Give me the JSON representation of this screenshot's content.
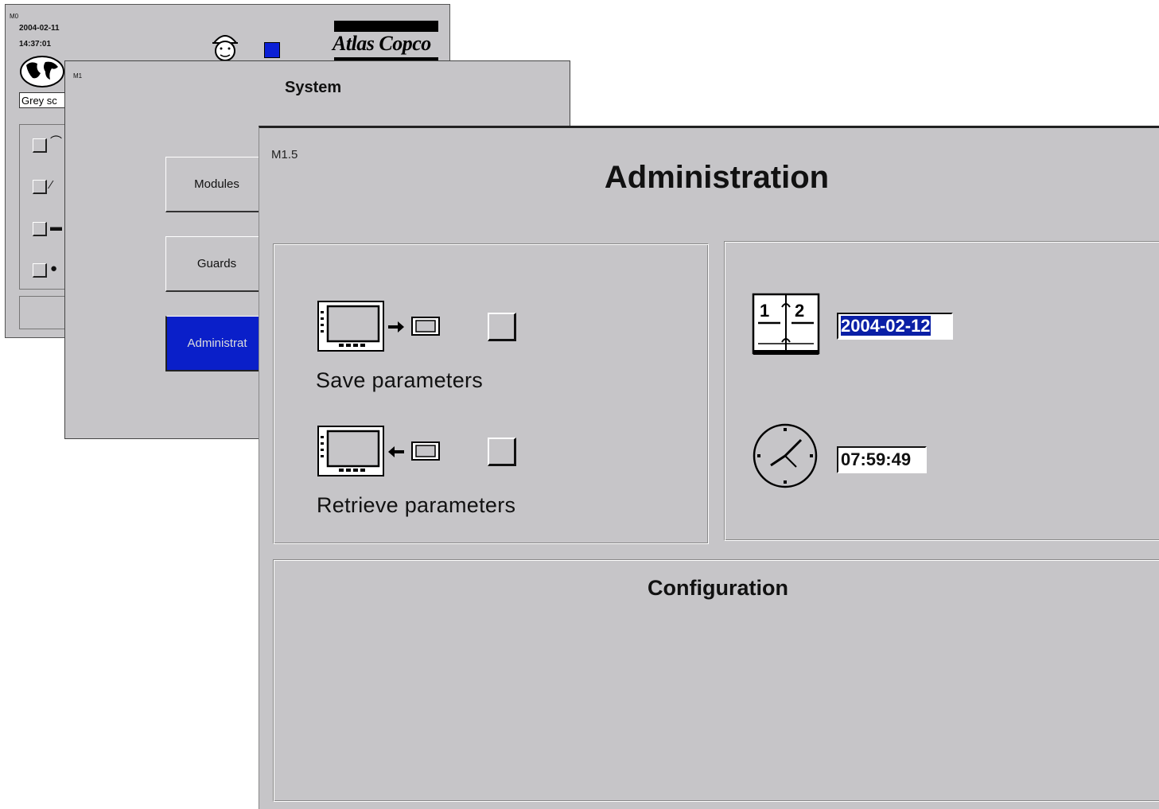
{
  "m0": {
    "id": "M0",
    "date": "2004-02-11",
    "time": "14:37:01",
    "logo": "Atlas Copco",
    "input_value": "Grey sc"
  },
  "m1": {
    "id": "M1",
    "title": "System",
    "buttons": [
      "Modules",
      "Guards",
      "Administrat"
    ]
  },
  "m15": {
    "id": "M1.5",
    "title": "Administration",
    "save_label": "Save parameters",
    "retrieve_label": "Retrieve parameters",
    "date_value": "2004-02-12",
    "time_value": "07:59:49",
    "config_title": "Configuration"
  },
  "colors": {
    "background": "#c6c5c8",
    "accent": "#0a1fc9",
    "selection": "#0a1fa6"
  },
  "icons": [
    "globe-icon",
    "operator-head-icon",
    "calendar-icon",
    "clock-icon",
    "save-to-card-icon",
    "retrieve-from-card-icon"
  ]
}
